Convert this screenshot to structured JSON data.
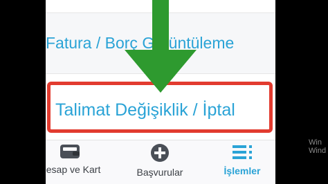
{
  "menu": {
    "fatura_label": "Fatura / Borç Görüntüleme",
    "talimat_label": "Talimat Değişiklik / İptal"
  },
  "tabbar": {
    "tabs": [
      {
        "label": "Hesap ve Kart",
        "icon": "wallet-icon"
      },
      {
        "label": "Başvurular",
        "icon": "plus-circle-icon"
      },
      {
        "label": "İşlemler",
        "icon": "list-icon",
        "active": true
      }
    ]
  },
  "watermark": {
    "line1": "Win",
    "line2": "Wind"
  },
  "colors": {
    "accent": "#2aa3d6",
    "highlight_border": "#e23b2f",
    "arrow": "#2e9a2f",
    "icon_dark": "#4a4f57"
  }
}
